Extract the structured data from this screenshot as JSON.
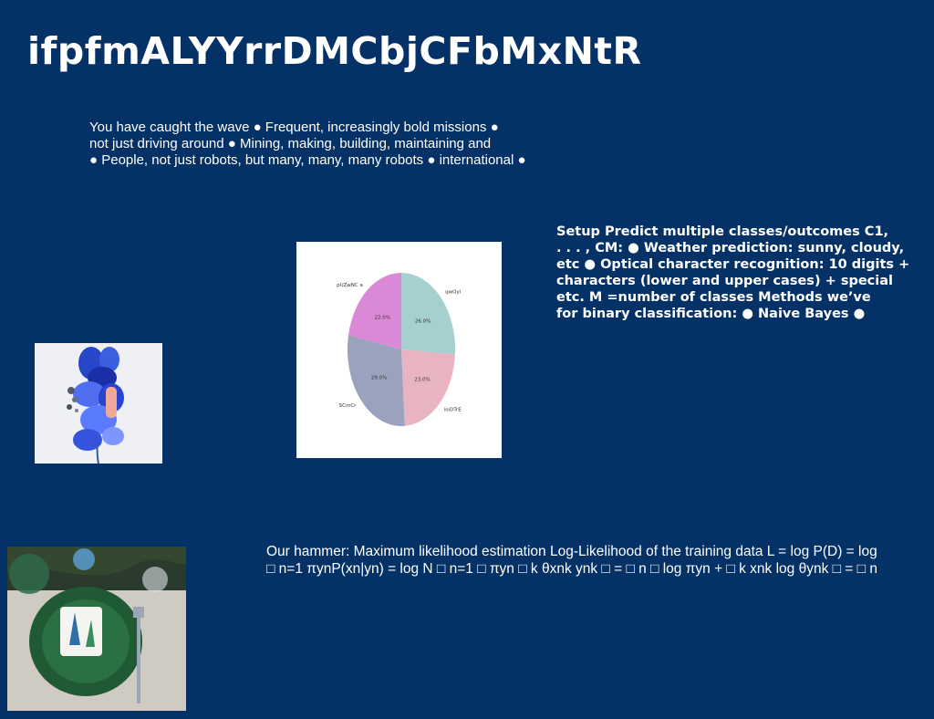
{
  "slide": {
    "title": "ifpfmALYYrrDMCbjCFbMxNtR",
    "background_color": "#043166",
    "text_color": "#ffffff"
  },
  "text_blocks": {
    "wave": "You have caught the wave ● Frequent, increasingly bold missions ●\nnot just driving around ● Mining, making, building, maintaining and\n● People, not just robots, but many, many, many robots ● international ●",
    "setup": "Setup Predict multiple classes/outcomes C1,\n. . . , CM: ● Weather prediction: sunny, cloudy,\netc ● Optical character recognition: 10 digits +\ncharacters (lower and upper cases) + special\netc. M =number of classes Methods we’ve\nfor binary classification: ● Naive Bayes ●",
    "hammer": "Our hammer: Maximum likelihood estimation Log-Likelihood of the training data L = log P(D) = log\n□ n=1 πynP(xn|yn) = log N □ n=1 □ πyn □ k θxnk ynk □ = □ n □ log πyn + □ k xnk log θynk □ = □ n"
  },
  "images": {
    "orchid": "photo of blue orchid flowers",
    "plate": "photo of green plate with wrapped gift"
  },
  "chart_data": {
    "type": "pie",
    "slices": [
      {
        "label": "qwOyl",
        "value": 26.0,
        "pct_text": "26.0%",
        "color": "#a6cfcf"
      },
      {
        "label": "ioiDTrE",
        "value": 23.0,
        "pct_text": "23.0%",
        "color": "#e8b4c2"
      },
      {
        "label": "SCmCr",
        "value": 29.0,
        "pct_text": "29.0%",
        "color": "#9aa2bd"
      },
      {
        "label": "pUZwNC a",
        "value": 22.0,
        "pct_text": "22.0%",
        "color": "#db88d6"
      }
    ],
    "start": "top",
    "direction": "clockwise",
    "title": "",
    "legend": "none"
  }
}
